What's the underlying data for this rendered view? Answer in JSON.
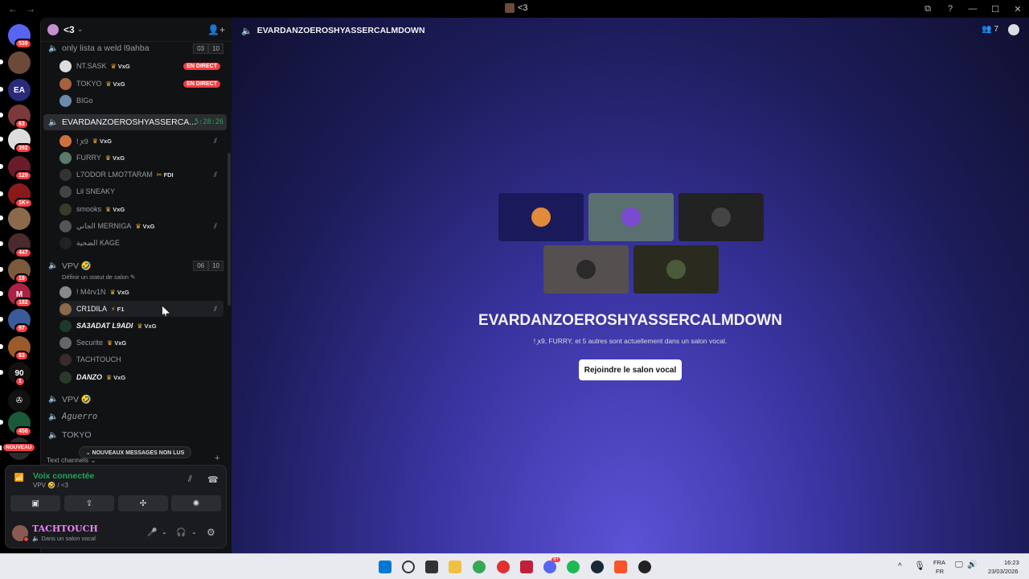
{
  "titlebar": {
    "back": "←",
    "forward": "→",
    "title": "<3",
    "buttons": [
      "⧉",
      "?",
      "—",
      "☐",
      "✕"
    ]
  },
  "servers": [
    {
      "badge": "539",
      "color": "#5865f2",
      "label": ""
    },
    {
      "badge": "",
      "color": "#6b4a3a",
      "label": ""
    },
    {
      "badge": "",
      "color": "#2a2a7a",
      "label": "EA"
    },
    {
      "badge": "63",
      "color": "#7a3a3a",
      "label": ""
    },
    {
      "badge": "392",
      "color": "#ddd",
      "label": ""
    },
    {
      "badge": "129",
      "color": "#6a1a2a",
      "label": ""
    },
    {
      "badge": "1K+",
      "color": "#8a1a1a",
      "label": ""
    },
    {
      "badge": "",
      "color": "#8a6a4a",
      "label": ""
    },
    {
      "badge": "447",
      "color": "#4a2a2a",
      "label": ""
    },
    {
      "badge": "19",
      "color": "#7a5a3a",
      "label": ""
    },
    {
      "badge": "182",
      "color": "#aa2244",
      "label": "M"
    },
    {
      "badge": "97",
      "color": "#3a5a9a",
      "label": ""
    },
    {
      "badge": "83",
      "color": "#9a5a2a",
      "label": ""
    },
    {
      "badge": "1",
      "color": "#111",
      "label": "90"
    },
    {
      "badge": "",
      "color": "#111",
      "label": "✇"
    },
    {
      "badge": "456",
      "color": "#1a5a3a",
      "label": ""
    },
    {
      "badge": "NOUVEAU",
      "color": "#2a2a2a",
      "label": ""
    }
  ],
  "sidebar": {
    "server_name": "<3",
    "channels": [
      {
        "name": "only lista a weld l9ahba",
        "counts": [
          "03",
          "10"
        ]
      },
      {
        "name": "EVARDANZOEROSHYASSERCA...",
        "timer": "5:28:26"
      },
      {
        "name": "VPV 🤣",
        "counts": [
          "06",
          "10"
        ],
        "status": "Définir un statut de salon ✎"
      },
      {
        "name": "VPV 🤣"
      },
      {
        "name": "Aguerro"
      },
      {
        "name": "TOKYO"
      }
    ],
    "users_a": [
      {
        "name": "NT.SASK",
        "tag": "VxG",
        "live": "EN DIRECT"
      },
      {
        "name": "TOKYO",
        "tag": "VxG",
        "live": "EN DIRECT"
      },
      {
        "name": "BIGo"
      }
    ],
    "users_b": [
      {
        "name": "! ꭗ9",
        "tag": "VxG"
      },
      {
        "name": "FURRY",
        "tag": "VxG"
      },
      {
        "name": "L7ODOR LMO7TARAM",
        "tag": "FDI"
      },
      {
        "name": "Lil SNEAKY"
      },
      {
        "name": "smooks",
        "tag": "VxG"
      },
      {
        "name": "الجاني MERNIGA",
        "tag": "VxG"
      },
      {
        "name": "الضحية KAGE"
      }
    ],
    "users_c": [
      {
        "name": "! M4rv1N",
        "tag": "VxG"
      },
      {
        "name": "CR1DILA",
        "tag": "F1"
      },
      {
        "name": "SA3ADAT L9ADI",
        "tag": "VxG"
      },
      {
        "name": "Securite",
        "tag": "VxG"
      },
      {
        "name": "TACHTOUCH"
      },
      {
        "name": "DANZO",
        "tag": "VxG"
      }
    ],
    "new_messages": "⌄ NOUVEAUX MESSAGES NON LUS",
    "text_channels": "Text channels ⌄",
    "text_channels_add": "+"
  },
  "voice": {
    "title": "Voix connectée",
    "subtitle": "VPV 🤣 / <3",
    "noise_icon": "⫽",
    "hangup_icon": "☎",
    "buttons": [
      "▣̸",
      "⇪",
      "✣",
      "✺"
    ]
  },
  "me": {
    "name": "TACHTOUCH",
    "status": "🔈 Dans un salon vocal",
    "controls": [
      "🎤",
      "⌄",
      "🎧",
      "⌄",
      "⚙"
    ]
  },
  "main": {
    "channel_title": "EVARDANZOEROSHYASSERCALMDOWN",
    "people_count": "7",
    "tiles": [
      {
        "bg": "#1a1a5a",
        "av": "#e08a3a"
      },
      {
        "bg": "#5a7070",
        "av": "#7a4ad0"
      },
      {
        "bg": "#222222",
        "av": "#444444"
      },
      {
        "bg": "#555050",
        "av": "#2a2a2a"
      },
      {
        "bg": "#2a2a1e",
        "av": "#4a5a3a"
      }
    ],
    "big_title": "EVARDANZOEROSHYASSERCALMDOWN",
    "subtitle": "! ꭗ9, FURRY, et 5 autres sont actuellement dans un salon vocal.",
    "join_button": "Rejoindre le salon vocal"
  },
  "taskbar": {
    "lang_top": "FRA",
    "lang_bottom": "FR",
    "time": "16:23",
    "date": "23/03/2026",
    "discord_badge": "9+"
  }
}
